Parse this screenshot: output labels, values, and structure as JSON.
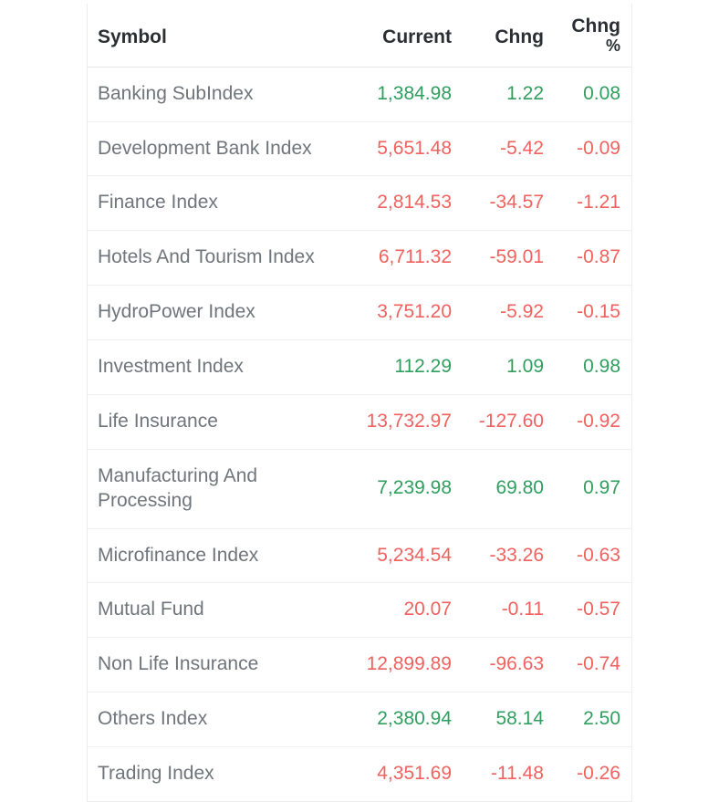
{
  "table": {
    "columns": [
      {
        "key": "symbol",
        "label": "Symbol",
        "align": "left"
      },
      {
        "key": "current",
        "label": "Current",
        "align": "right"
      },
      {
        "key": "chng",
        "label": "Chng",
        "align": "right"
      },
      {
        "key": "chng_pct_line1",
        "label": "Chng",
        "align": "right"
      },
      {
        "key": "chng_pct_line2",
        "label": "%",
        "align": "right"
      }
    ],
    "header": {
      "symbol": "Symbol",
      "current": "Current",
      "chng": "Chng",
      "chng_pct_line1": "Chng",
      "chng_pct_line2": "%"
    },
    "colors": {
      "up": "#2f9e5e",
      "down": "#f0625f",
      "symbol_text": "#6f757b",
      "header_text": "#2b2f33",
      "row_border": "#efefef",
      "background": "#ffffff"
    },
    "rows": [
      {
        "symbol": "Banking SubIndex",
        "current": "1,384.98",
        "chng": "1.22",
        "chng_pct": "0.08",
        "direction": "up"
      },
      {
        "symbol": "Development Bank Index",
        "current": "5,651.48",
        "chng": "-5.42",
        "chng_pct": "-0.09",
        "direction": "down"
      },
      {
        "symbol": "Finance Index",
        "current": "2,814.53",
        "chng": "-34.57",
        "chng_pct": "-1.21",
        "direction": "down"
      },
      {
        "symbol": "Hotels And Tourism Index",
        "current": "6,711.32",
        "chng": "-59.01",
        "chng_pct": "-0.87",
        "direction": "down"
      },
      {
        "symbol": "HydroPower Index",
        "current": "3,751.20",
        "chng": "-5.92",
        "chng_pct": "-0.15",
        "direction": "down"
      },
      {
        "symbol": "Investment Index",
        "current": "112.29",
        "chng": "1.09",
        "chng_pct": "0.98",
        "direction": "up"
      },
      {
        "symbol": "Life Insurance",
        "current": "13,732.97",
        "chng": "-127.60",
        "chng_pct": "-0.92",
        "direction": "down"
      },
      {
        "symbol": "Manufacturing And Processing",
        "current": "7,239.98",
        "chng": "69.80",
        "chng_pct": "0.97",
        "direction": "up"
      },
      {
        "symbol": "Microfinance Index",
        "current": "5,234.54",
        "chng": "-33.26",
        "chng_pct": "-0.63",
        "direction": "down"
      },
      {
        "symbol": "Mutual Fund",
        "current": "20.07",
        "chng": "-0.11",
        "chng_pct": "-0.57",
        "direction": "down"
      },
      {
        "symbol": "Non Life Insurance",
        "current": "12,899.89",
        "chng": "-96.63",
        "chng_pct": "-0.74",
        "direction": "down"
      },
      {
        "symbol": "Others Index",
        "current": "2,380.94",
        "chng": "58.14",
        "chng_pct": "2.50",
        "direction": "up"
      },
      {
        "symbol": "Trading Index",
        "current": "4,351.69",
        "chng": "-11.48",
        "chng_pct": "-0.26",
        "direction": "down"
      }
    ]
  }
}
